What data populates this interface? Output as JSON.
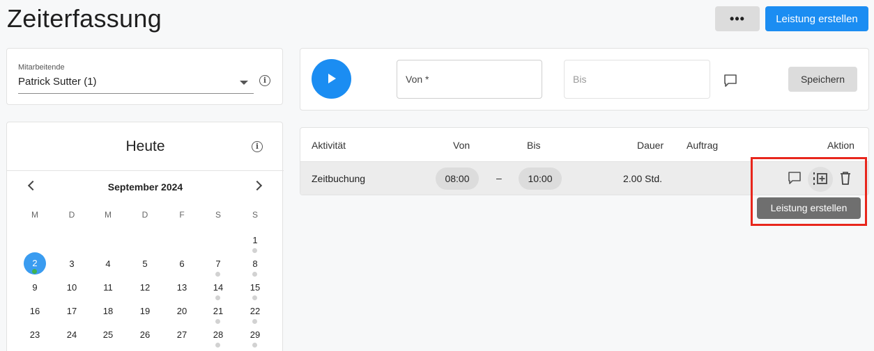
{
  "header": {
    "title": "Zeiterfassung",
    "more_label": "•••",
    "create_label": "Leistung erstellen"
  },
  "employee": {
    "label": "Mitarbeitende",
    "value": "Patrick Sutter (1)"
  },
  "calendar": {
    "title": "Heute",
    "month": "September 2024",
    "weekdays": [
      "M",
      "D",
      "M",
      "D",
      "F",
      "S",
      "S"
    ],
    "rows": [
      [
        "",
        "",
        "",
        "",
        "",
        "",
        "1"
      ],
      [
        "2",
        "3",
        "4",
        "5",
        "6",
        "7",
        "8"
      ],
      [
        "9",
        "10",
        "11",
        "12",
        "13",
        "14",
        "15"
      ],
      [
        "16",
        "17",
        "18",
        "19",
        "20",
        "21",
        "22"
      ],
      [
        "23",
        "24",
        "25",
        "26",
        "27",
        "28",
        "29"
      ]
    ],
    "today": "2",
    "marked_days": [
      "1",
      "2",
      "7",
      "8",
      "14",
      "15",
      "21",
      "22",
      "28",
      "29"
    ]
  },
  "timer": {
    "von_placeholder": "Von *",
    "bis_placeholder": "Bis",
    "save_label": "Speichern"
  },
  "table": {
    "headers": {
      "activity": "Aktivität",
      "from": "Von",
      "to": "Bis",
      "duration": "Dauer",
      "order": "Auftrag",
      "action": "Aktion"
    },
    "rows": [
      {
        "activity": "Zeitbuchung",
        "from": "08:00",
        "separator": "–",
        "to": "10:00",
        "duration": "2.00 Std.",
        "order": ""
      }
    ]
  },
  "tooltip": "Leistung erstellen",
  "colors": {
    "primary": "#1b8df2",
    "highlight": "#e8261c",
    "today": "#3a9cf0",
    "today_dot": "#3fb34f"
  }
}
